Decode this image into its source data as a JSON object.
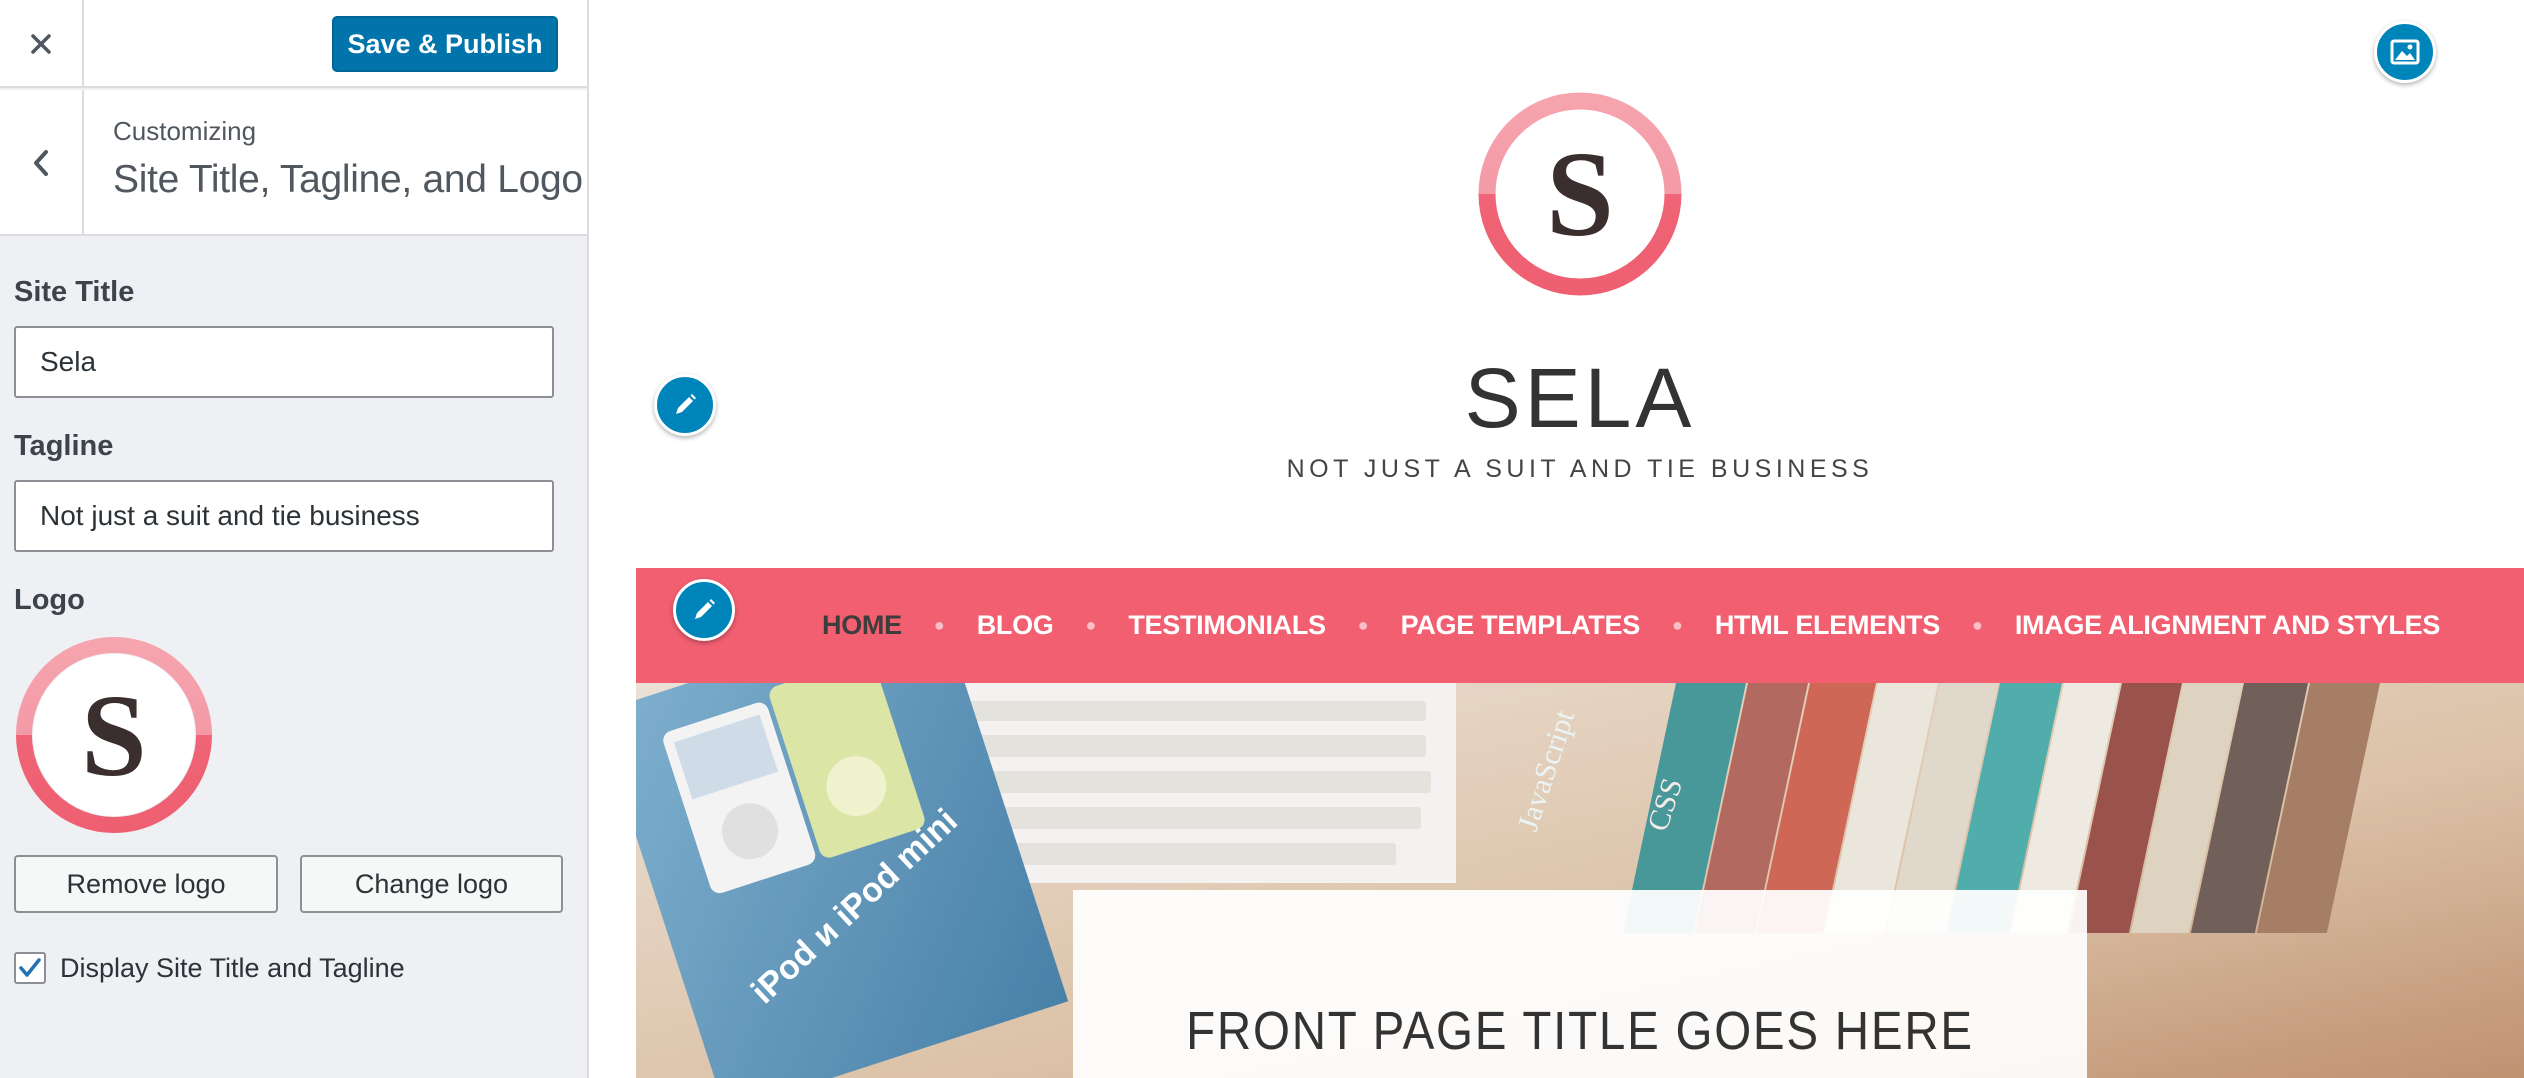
{
  "sidebar": {
    "save_label": "Save & Publish",
    "breadcrumb": "Customizing",
    "section_title": "Site Title, Tagline, and Logo",
    "site_title_label": "Site Title",
    "site_title_value": "Sela",
    "tagline_label": "Tagline",
    "tagline_value": "Not just a suit and tie business",
    "logo_label": "Logo",
    "logo_letter": "S",
    "remove_logo_label": "Remove logo",
    "change_logo_label": "Change logo",
    "display_checkbox_label": "Display Site Title and Tagline",
    "display_checked": true
  },
  "preview": {
    "site_title": "SELA",
    "tagline": "NOT JUST A SUIT AND TIE BUSINESS",
    "logo_letter": "S",
    "nav": [
      {
        "label": "HOME",
        "current": true
      },
      {
        "label": "BLOG"
      },
      {
        "label": "TESTIMONIALS"
      },
      {
        "label": "PAGE TEMPLATES"
      },
      {
        "label": "HTML ELEMENTS"
      },
      {
        "label": "IMAGE ALIGNMENT AND STYLES"
      }
    ],
    "hero_title": "FRONT PAGE TITLE GOES HERE",
    "hero_image_texts": {
      "magazine": "iPod и iPod mini",
      "book_1": "JavaScript",
      "book_2": "CSS"
    }
  },
  "colors": {
    "accent": "#0085ba",
    "save_button": "#0074ab",
    "nav_bar": "#f25f70",
    "logo_ring": "#f06b7d"
  },
  "icons": {
    "close": "close-icon",
    "back": "chevron-left-icon",
    "edit": "pencil-icon",
    "header_image": "image-icon",
    "checkbox": "checkmark-icon"
  }
}
